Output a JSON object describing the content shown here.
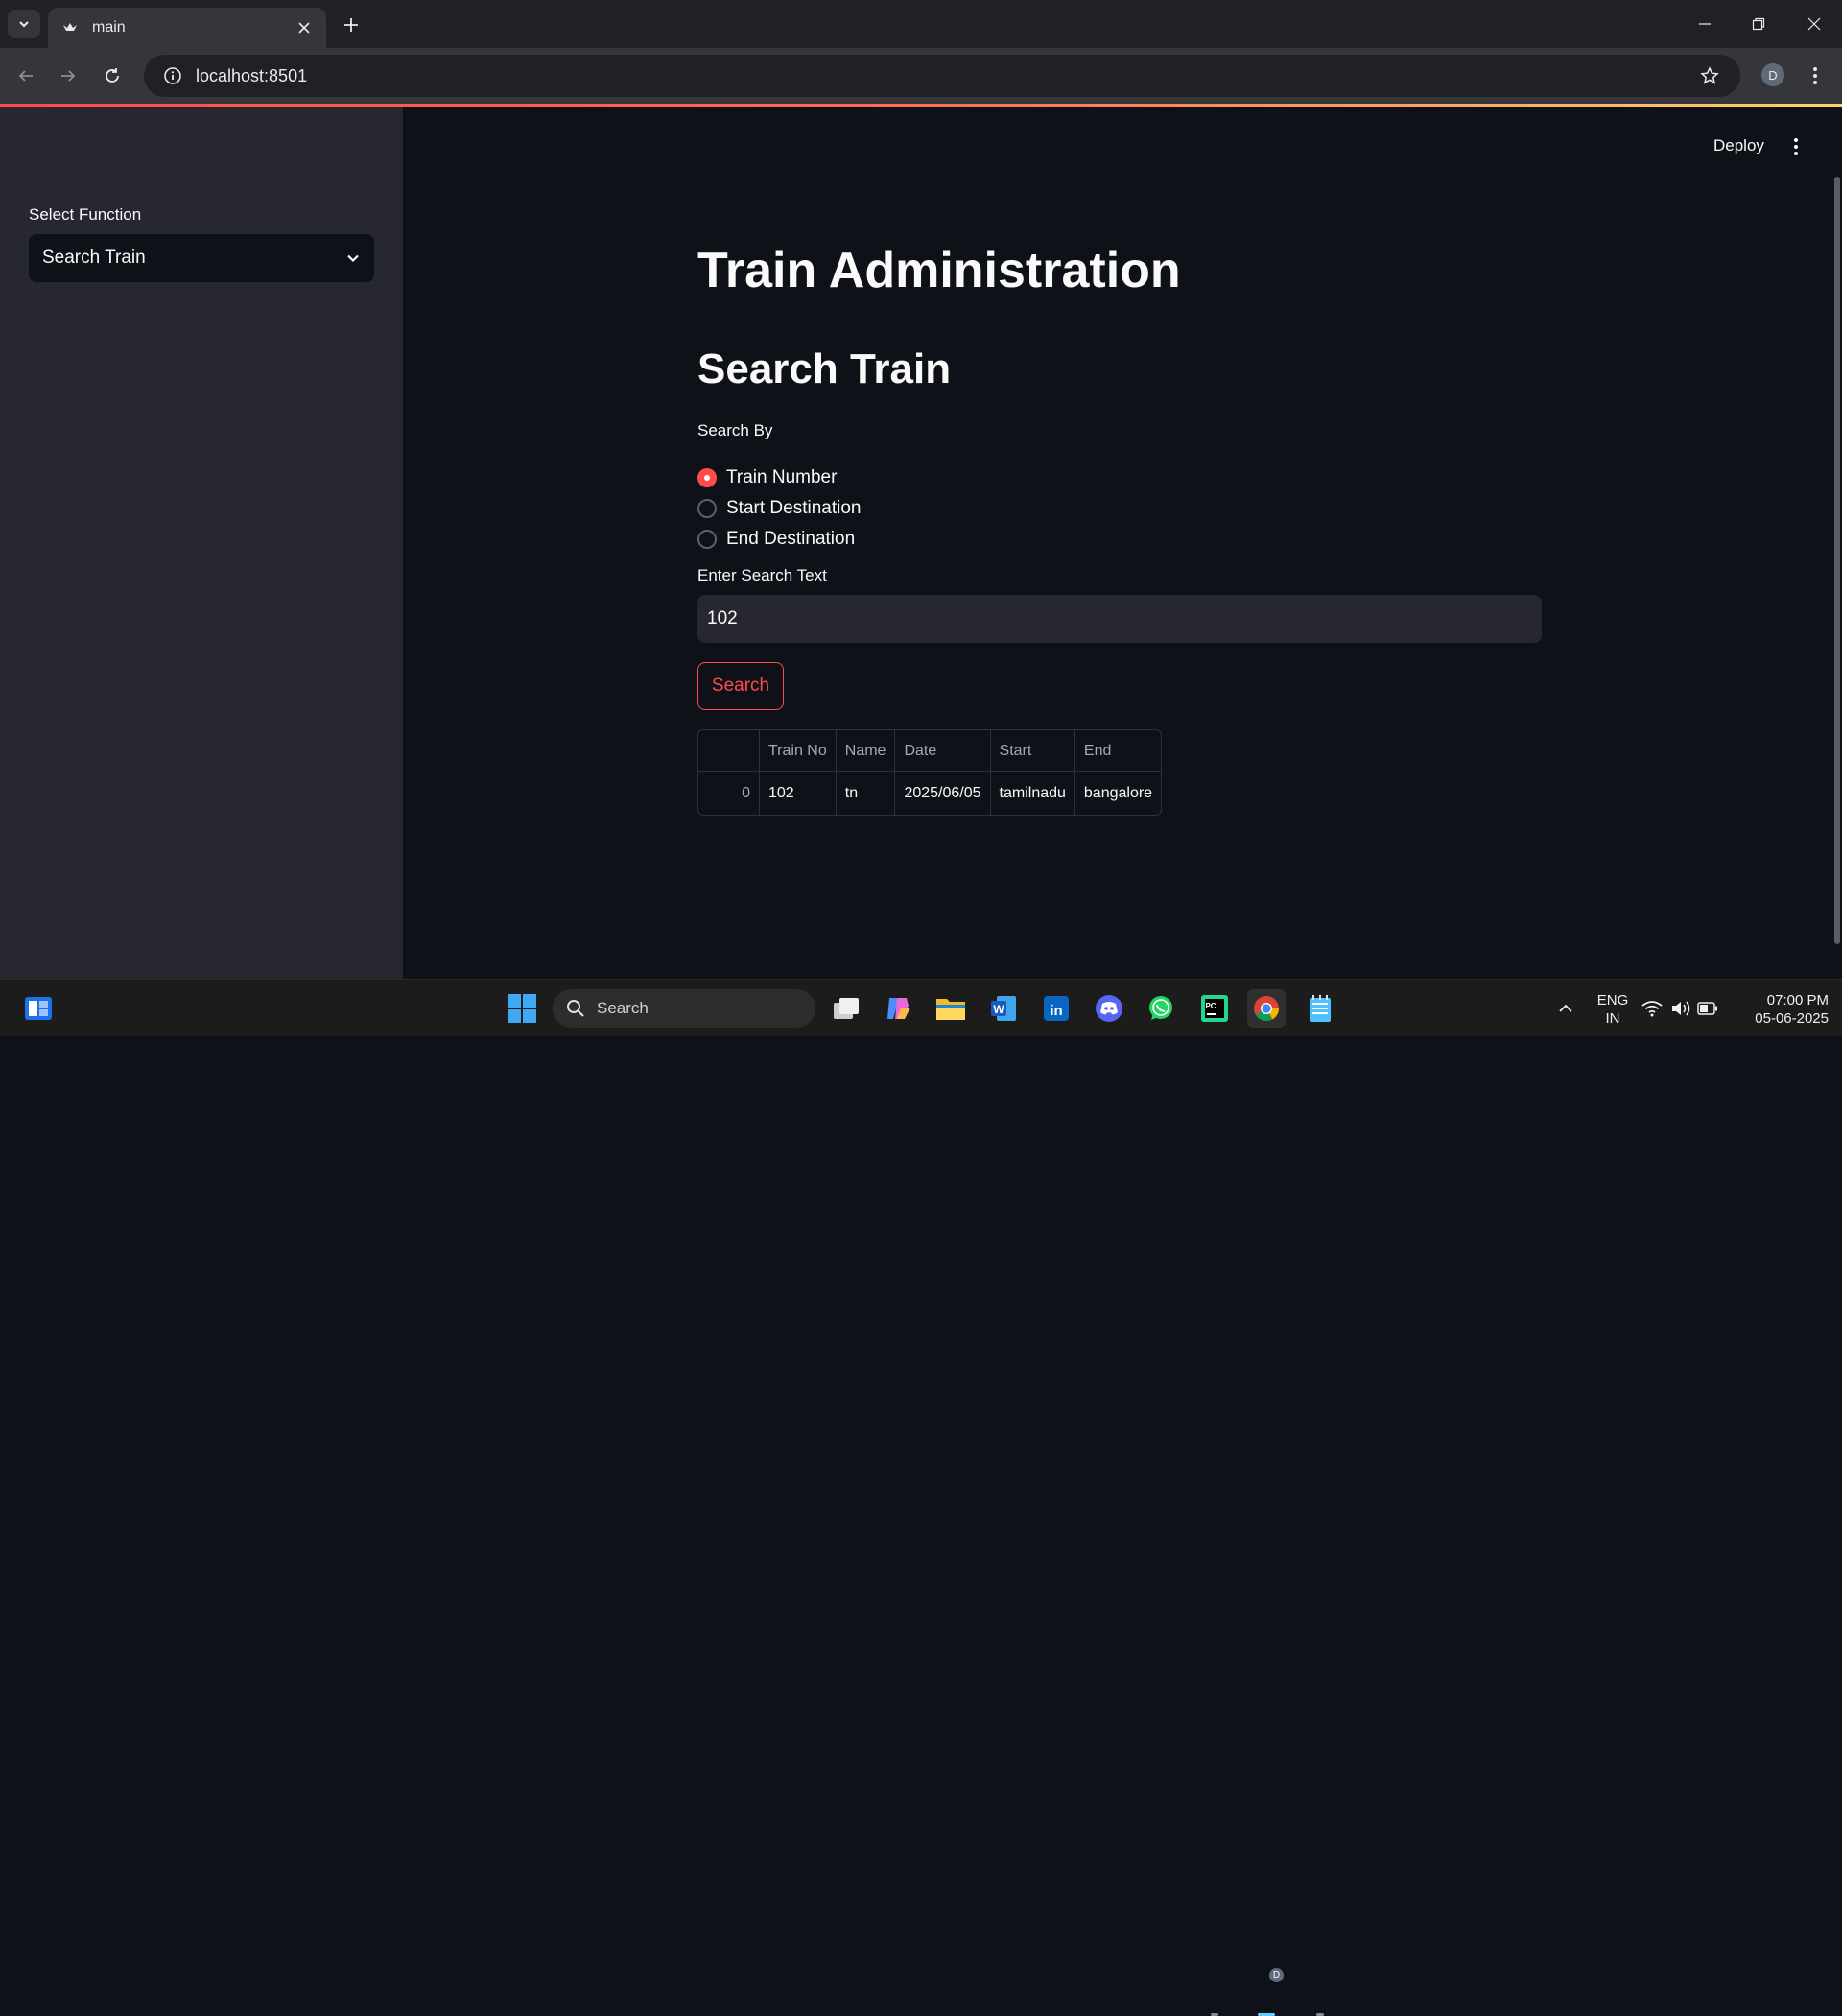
{
  "browser": {
    "tab_title": "main",
    "url": "localhost:8501",
    "profile_initial": "D"
  },
  "sidebar": {
    "select_label": "Select Function",
    "select_value": "Search Train"
  },
  "header": {
    "deploy_label": "Deploy"
  },
  "main": {
    "title": "Train Administration",
    "subtitle": "Search Train",
    "search_by_label": "Search By",
    "radio_options": [
      {
        "label": "Train Number",
        "selected": true
      },
      {
        "label": "Start Destination",
        "selected": false
      },
      {
        "label": "End Destination",
        "selected": false
      }
    ],
    "search_text_label": "Enter Search Text",
    "search_text_value": "102",
    "search_button": "Search",
    "table": {
      "columns": [
        "",
        "Train No",
        "Name",
        "Date",
        "Start",
        "End"
      ],
      "rows": [
        [
          "0",
          "102",
          "tn",
          "2025/06/05",
          "tamilnadu",
          "bangalore"
        ]
      ]
    }
  },
  "taskbar": {
    "search_placeholder": "Search",
    "lang_top": "ENG",
    "lang_bottom": "IN",
    "time": "07:00 PM",
    "date": "05-06-2025",
    "chrome_badge": "D"
  },
  "colors": {
    "accent": "#ff4b4b",
    "app_bg": "#0e1117",
    "sidebar_bg": "#262730"
  }
}
